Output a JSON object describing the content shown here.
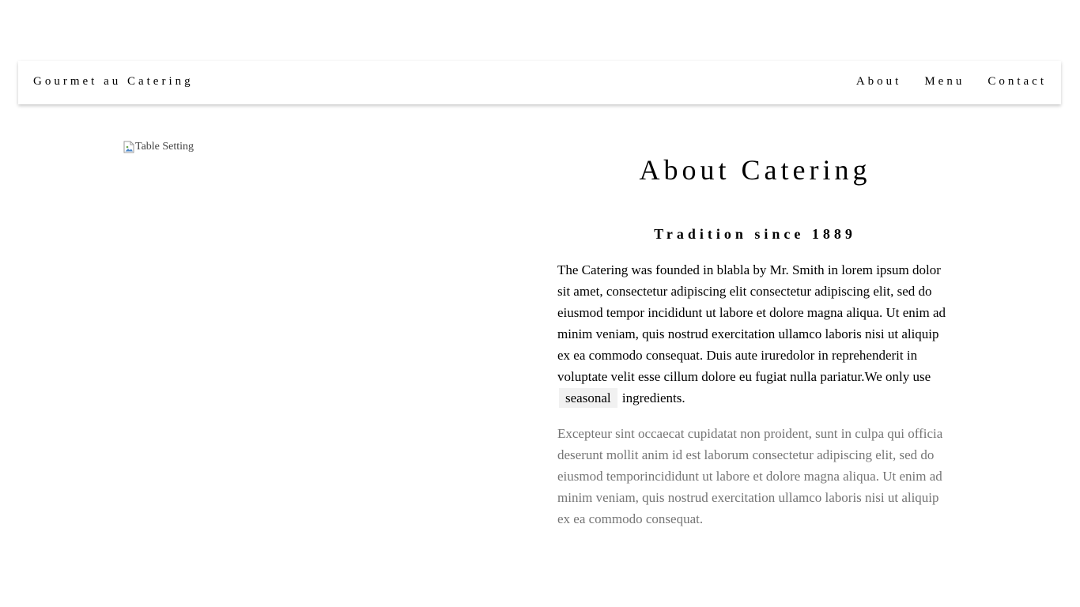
{
  "nav": {
    "brand": "Gourmet au Catering",
    "links": [
      "About",
      "Menu",
      "Contact"
    ]
  },
  "image": {
    "alt": "Table Setting"
  },
  "about": {
    "title": "About Catering",
    "subtitle": "Tradition since 1889",
    "paragraph1_before": "The Catering was founded in blabla by Mr. Smith in lorem ipsum dolor sit amet, consectetur adipiscing elit consectetur adipiscing elit, sed do eiusmod tempor incididunt ut labore et dolore magna aliqua. Ut enim ad minim veniam, quis nostrud exercitation ullamco laboris nisi ut aliquip ex ea commodo consequat. Duis aute iruredolor in reprehenderit in voluptate velit esse cillum dolore eu fugiat nulla pariatur.We only use",
    "paragraph1_tag": "seasonal",
    "paragraph1_after": "ingredients.",
    "paragraph2": "Excepteur sint occaecat cupidatat non proident, sunt in culpa qui officia deserunt mollit anim id est laborum consectetur adipiscing elit, sed do eiusmod temporincididunt ut labore et dolore magna aliqua. Ut enim ad minim veniam, quis nostrud exercitation ullamco laboris nisi ut aliquip ex ea commodo consequat."
  },
  "colors": {
    "muted_text": "#757575",
    "tag_bg": "#f1f1f1"
  }
}
